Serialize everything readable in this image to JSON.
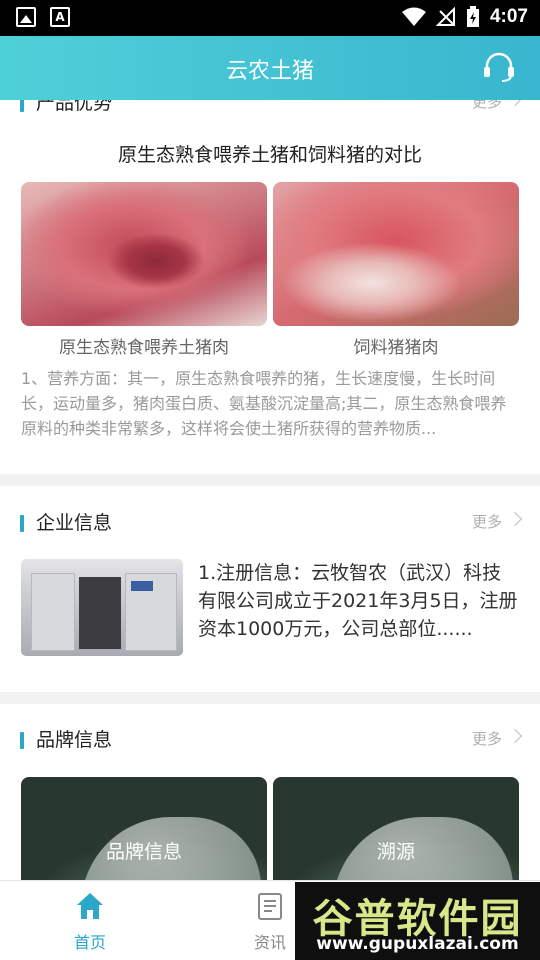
{
  "status_bar": {
    "time": "4:07"
  },
  "header": {
    "title": "云农土猪"
  },
  "advantage": {
    "title": "产品优势",
    "more": "更多",
    "compare_title": "原生态熟食喂养土猪和饲料猪的对比",
    "captions": [
      "原生态熟食喂养土猪肉",
      "饲料猪猪肉"
    ],
    "description": "1、营养方面：其一，原生态熟食喂养的猪，生长速度慢，生长时间长，运动量多，猪肉蛋白质、氨基酸沉淀量高;其二，原生态熟食喂养原料的种类非常繁多，这样将会使土猪所获得的营养物质..."
  },
  "company": {
    "title": "企业信息",
    "more": "更多",
    "description": "1.注册信息：云牧智农（武汉）科技有限公司成立于2021年3月5日，注册资本1000万元，公司总部位......"
  },
  "brand": {
    "title": "品牌信息",
    "more": "更多",
    "tiles": [
      "品牌信息",
      "溯源"
    ]
  },
  "nav": {
    "items": [
      {
        "label": "首页",
        "icon": "home-icon",
        "active": true
      },
      {
        "label": "资讯",
        "icon": "news-icon",
        "active": false
      }
    ]
  },
  "watermark": {
    "title": "谷普软件园",
    "url": "www.gupuxlazai.com"
  },
  "colors": {
    "accent": "#2aa7c9",
    "header_start": "#4fd0d8",
    "header_end": "#38b6cf"
  }
}
